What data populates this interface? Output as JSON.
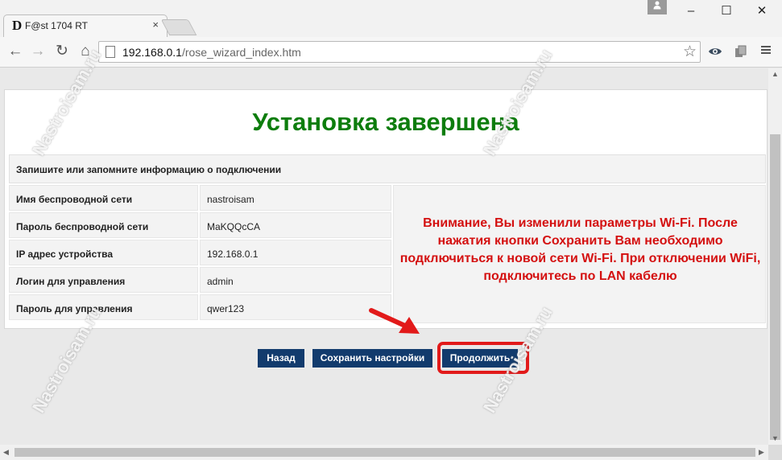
{
  "browser": {
    "tab_title": "F@st 1704 RT",
    "tab_favicon": "D",
    "tab_close": "×",
    "user_icon": "user-icon",
    "window": {
      "minimize": "–",
      "maximize": "☐",
      "close": "✕"
    },
    "nav": {
      "back": "←",
      "forward": "→",
      "reload": "↻",
      "home": "⌂"
    },
    "address": {
      "host": "192.168.0.1",
      "path": "/rose_wizard_index.htm"
    },
    "star": "☆",
    "extensions": [
      "shield-eye-icon",
      "copy-icon",
      "menu-icon"
    ]
  },
  "page": {
    "title": "Установка завершена",
    "info_row": "Запишите или запомните информацию о подключении",
    "rows": [
      {
        "label": "Имя беспроводной сети",
        "value": "nastroisam"
      },
      {
        "label": "Пароль беспроводной сети",
        "value": "MaKQQcCA"
      },
      {
        "label": "IP адрес устройства",
        "value": "192.168.0.1"
      },
      {
        "label": "Логин для управления",
        "value": "admin"
      },
      {
        "label": "Пароль для управления",
        "value": "qwer123"
      }
    ],
    "warning": "Внимание, Вы изменили параметры Wi-Fi. После нажатия кнопки Сохранить Вам необходимо подключиться к новой сети Wi-Fi. При отключении WiFi, подключитесь по LAN кабелю",
    "buttons": {
      "back": "Назад",
      "save": "Сохранить настройки",
      "continue": "Продолжить"
    }
  },
  "watermark": "Nastroisam.ru",
  "colors": {
    "title": "#0d7d0d",
    "warning": "#d41010",
    "button": "#123b6d",
    "highlight": "#e21a1a"
  }
}
